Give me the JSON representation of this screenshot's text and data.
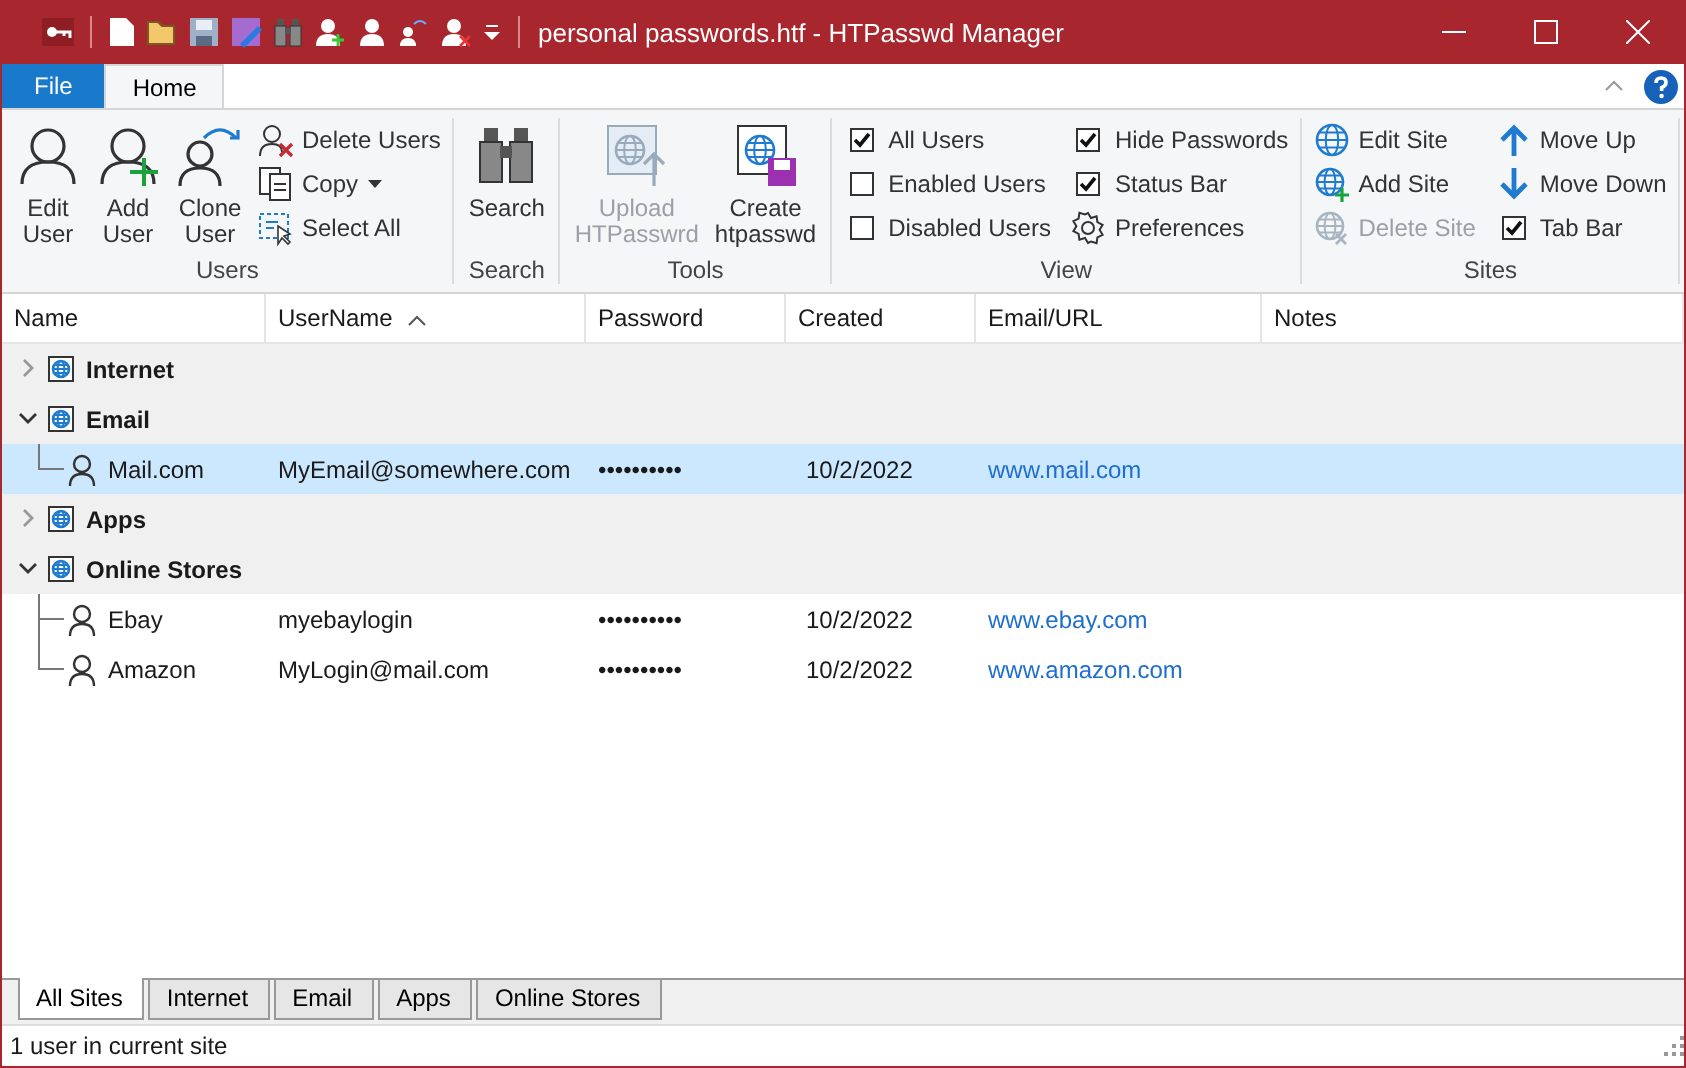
{
  "window": {
    "title": "personal passwords.htf - HTPasswd Manager"
  },
  "ribbon_tabs": [
    {
      "label": "File",
      "kind": "file",
      "selected": false
    },
    {
      "label": "Home",
      "kind": "tab",
      "selected": true
    }
  ],
  "ribbon_groups": [
    {
      "label": "Users",
      "large": [
        {
          "label": "Edit User",
          "disabled": false
        },
        {
          "label": "Add User",
          "disabled": false
        },
        {
          "label": "Clone User",
          "disabled": false
        }
      ],
      "small": [
        {
          "label": "Delete Users",
          "kind": "button",
          "disabled": false
        },
        {
          "label": "Copy",
          "kind": "menu",
          "disabled": false
        },
        {
          "label": "Select All",
          "kind": "button",
          "disabled": false
        }
      ]
    },
    {
      "label": "Search",
      "large": [
        {
          "label": "Search",
          "disabled": false
        }
      ]
    },
    {
      "label": "Tools",
      "large": [
        {
          "label": "Upload HTPasswrd",
          "disabled": true
        },
        {
          "label": "Create htpasswd",
          "disabled": false
        }
      ]
    },
    {
      "label": "View",
      "small": [
        {
          "label": "All Users",
          "kind": "check",
          "checked": true
        },
        {
          "label": "Enabled Users",
          "kind": "check",
          "checked": false
        },
        {
          "label": "Disabled Users",
          "kind": "check",
          "checked": false
        },
        {
          "label": "Hide Passwords",
          "kind": "check",
          "checked": true
        },
        {
          "label": "Status Bar",
          "kind": "check",
          "checked": true
        },
        {
          "label": "Preferences",
          "kind": "button",
          "disabled": false
        }
      ]
    },
    {
      "label": "Sites",
      "small": [
        {
          "label": "Edit Site",
          "kind": "button",
          "disabled": false
        },
        {
          "label": "Add Site",
          "kind": "button",
          "disabled": false
        },
        {
          "label": "Delete Site",
          "kind": "button",
          "disabled": true
        },
        {
          "label": "Move Up",
          "kind": "button",
          "disabled": false
        },
        {
          "label": "Move Down",
          "kind": "button",
          "disabled": false
        },
        {
          "label": "Tab Bar",
          "kind": "check",
          "checked": true
        }
      ]
    }
  ],
  "table": {
    "columns": [
      {
        "label": "Name",
        "sorted": false
      },
      {
        "label": "UserName",
        "sorted": true
      },
      {
        "label": "Password",
        "sorted": false
      },
      {
        "label": "Created",
        "sorted": false
      },
      {
        "label": "Email/URL",
        "sorted": false
      },
      {
        "label": "Notes",
        "sorted": false
      }
    ],
    "sites": [
      {
        "name": "Internet",
        "expanded": false
      },
      {
        "name": "Email",
        "expanded": true,
        "children": [
          {
            "name": "Mail.com",
            "username": "MyEmail@somewhere.com",
            "password": "••••••••••",
            "created": "10/2/2022",
            "url": "www.mail.com",
            "selected": true
          }
        ]
      },
      {
        "name": "Apps",
        "expanded": false
      },
      {
        "name": "Online Stores",
        "expanded": true,
        "children": [
          {
            "name": "Ebay",
            "username": "myebaylogin",
            "password": "••••••••••",
            "created": "10/2/2022",
            "url": "www.ebay.com",
            "selected": false
          },
          {
            "name": "Amazon",
            "username": "MyLogin@mail.com",
            "password": "••••••••••",
            "created": "10/2/2022",
            "url": "www.amazon.com",
            "selected": false
          }
        ]
      }
    ]
  },
  "site_tabs": [
    {
      "label": "All Sites",
      "selected": true
    },
    {
      "label": "Internet",
      "selected": false
    },
    {
      "label": "Email",
      "selected": false
    },
    {
      "label": "Apps",
      "selected": false
    },
    {
      "label": "Online Stores",
      "selected": false
    }
  ],
  "status_bar": {
    "text": "1 user in current site"
  }
}
